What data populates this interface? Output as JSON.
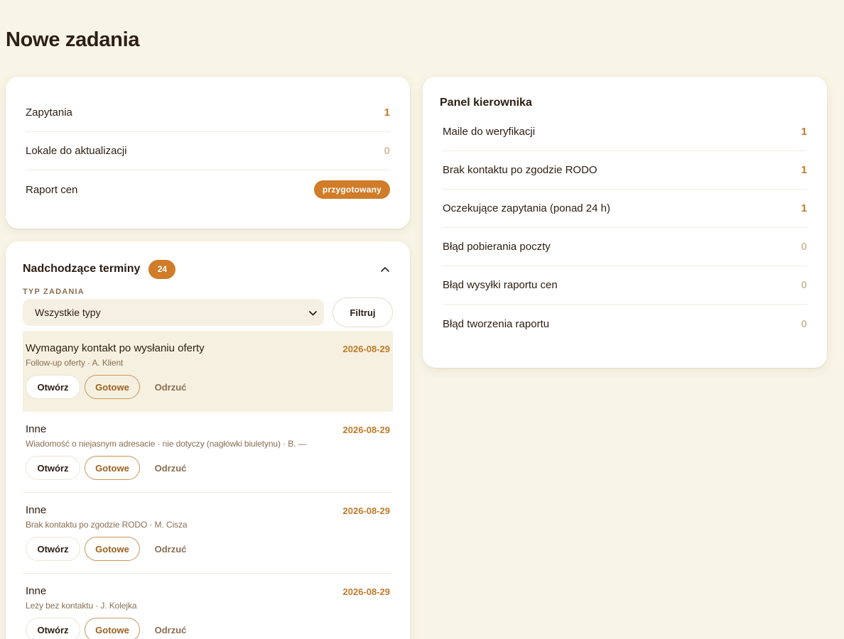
{
  "page": {
    "title": "Nowe zadania"
  },
  "new_tasks": {
    "rows": [
      {
        "label": "Zapytania",
        "value": "1"
      },
      {
        "label": "Lokale do aktualizacji",
        "value": "0"
      },
      {
        "label": "Raport cen",
        "badge": "przygotowany"
      }
    ]
  },
  "upcoming": {
    "title": "Nadchodzące terminy",
    "count": "24",
    "filter_label": "TYP ZADANIA",
    "filter_selected": "Wszystkie typy",
    "filter_button": "Filtruj",
    "actions": {
      "open": "Otwórz",
      "done": "Gotowe",
      "reject": "Odrzuć"
    },
    "tasks": [
      {
        "title": "Wymagany kontakt po wysłaniu oferty",
        "date": "2026-08-29",
        "sub": "Follow-up oferty · A. Klient"
      },
      {
        "title": "Inne",
        "date": "2026-08-29",
        "sub": "Wiadomość o niejasnym adresacie · nie dotyczy (nagłówki biuletynu) · B. —"
      },
      {
        "title": "Inne",
        "date": "2026-08-29",
        "sub": "Brak kontaktu po zgodzie RODO · M. Cisza"
      },
      {
        "title": "Inne",
        "date": "2026-08-29",
        "sub": "Leży bez kontaktu · J. Kolejka"
      }
    ]
  },
  "manager": {
    "title": "Panel kierownika",
    "rows": [
      {
        "label": "Maile do weryfikacji",
        "value": "1"
      },
      {
        "label": "Brak kontaktu po zgodzie RODO",
        "value": "1"
      },
      {
        "label": "Oczekujące zapytania (ponad 24 h)",
        "value": "1"
      },
      {
        "label": "Błąd pobierania poczty",
        "value": "0"
      },
      {
        "label": "Błąd wysyłki raportu cen",
        "value": "0"
      },
      {
        "label": "Błąd tworzenia raportu",
        "value": "0"
      }
    ]
  },
  "colors": {
    "accent": "#d07c28",
    "background": "#f8f4e6",
    "muted": "#cfbfa1"
  }
}
